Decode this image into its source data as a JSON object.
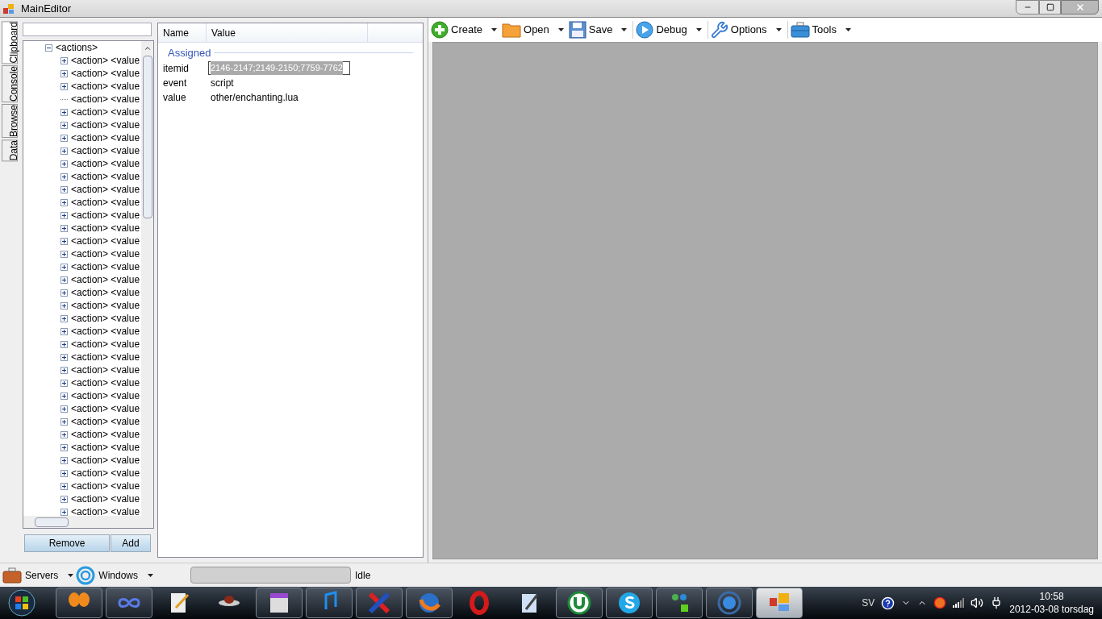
{
  "window": {
    "title": "MainEditor"
  },
  "side_tabs": [
    {
      "label": "Clipboard",
      "selected": true
    },
    {
      "label": "Console",
      "selected": false
    },
    {
      "label": "Browse",
      "selected": false
    },
    {
      "label": "Data",
      "selected": false
    }
  ],
  "tree": {
    "root": {
      "label": "<actions>",
      "expanded": true,
      "children": [
        {
          "label": "<action> <value",
          "expandable": true
        },
        {
          "label": "<action> <value",
          "expandable": true
        },
        {
          "label": "<action> <value",
          "expandable": true
        },
        {
          "label": "<action> <value",
          "expandable": false
        },
        {
          "label": "<action> <value",
          "expandable": true
        },
        {
          "label": "<action> <value",
          "expandable": true
        },
        {
          "label": "<action> <value",
          "expandable": true
        },
        {
          "label": "<action> <value",
          "expandable": true
        },
        {
          "label": "<action> <value",
          "expandable": true
        },
        {
          "label": "<action> <value",
          "expandable": true
        },
        {
          "label": "<action> <value",
          "expandable": true
        },
        {
          "label": "<action> <value",
          "expandable": true
        },
        {
          "label": "<action> <value",
          "expandable": true
        },
        {
          "label": "<action> <value",
          "expandable": true
        },
        {
          "label": "<action> <value",
          "expandable": true
        },
        {
          "label": "<action> <value",
          "expandable": true
        },
        {
          "label": "<action> <value",
          "expandable": true
        },
        {
          "label": "<action> <value",
          "expandable": true
        },
        {
          "label": "<action> <value",
          "expandable": true
        },
        {
          "label": "<action> <value",
          "expandable": true
        },
        {
          "label": "<action> <value",
          "expandable": true
        },
        {
          "label": "<action> <value",
          "expandable": true
        },
        {
          "label": "<action> <value",
          "expandable": true
        },
        {
          "label": "<action> <value",
          "expandable": true
        },
        {
          "label": "<action> <value",
          "expandable": true
        },
        {
          "label": "<action> <value",
          "expandable": true
        },
        {
          "label": "<action> <value",
          "expandable": true
        },
        {
          "label": "<action> <value",
          "expandable": true
        },
        {
          "label": "<action> <value",
          "expandable": true
        },
        {
          "label": "<action> <value",
          "expandable": true
        },
        {
          "label": "<action> <value",
          "expandable": true
        },
        {
          "label": "<action> <value",
          "expandable": true
        },
        {
          "label": "<action> <value",
          "expandable": true
        },
        {
          "label": "<action> <value",
          "expandable": true
        },
        {
          "label": "<action> <value",
          "expandable": true
        },
        {
          "label": "<action> <value",
          "expandable": true
        }
      ]
    }
  },
  "tree_buttons": [
    "Remove",
    "Add"
  ],
  "property_grid": {
    "columns": [
      "Name",
      "Value"
    ],
    "category": "Assigned",
    "rows": [
      {
        "name": "itemid",
        "value": "2146-2147;2149-2150;7759-7762",
        "editing": true
      },
      {
        "name": "event",
        "value": "script",
        "editing": false
      },
      {
        "name": "value",
        "value": "other/enchanting.lua",
        "editing": false
      }
    ]
  },
  "toolbar": [
    {
      "kind": "create",
      "label": "Create"
    },
    {
      "kind": "open",
      "label": "Open"
    },
    {
      "kind": "save",
      "label": "Save"
    },
    {
      "kind": "debug",
      "label": "Debug"
    },
    {
      "kind": "options",
      "label": "Options"
    },
    {
      "kind": "tools",
      "label": "Tools"
    }
  ],
  "status_bar": {
    "menus": [
      {
        "kind": "servers",
        "label": "Servers"
      },
      {
        "kind": "windows",
        "label": "Windows"
      }
    ],
    "progress": {
      "level": 0
    },
    "status": "Idle"
  },
  "taskbar": {
    "apps": [
      {
        "kind": "butterfly",
        "running": true,
        "selected": false
      },
      {
        "kind": "infinity",
        "running": true,
        "selected": false
      },
      {
        "kind": "notepad",
        "running": false,
        "selected": false
      },
      {
        "kind": "ufo",
        "running": false,
        "selected": false
      },
      {
        "kind": "store",
        "running": true,
        "selected": false
      },
      {
        "kind": "music",
        "running": true,
        "selected": false
      },
      {
        "kind": "cross",
        "running": true,
        "selected": false
      },
      {
        "kind": "firefox",
        "running": true,
        "selected": false
      },
      {
        "kind": "opera",
        "running": false,
        "selected": false
      },
      {
        "kind": "pen",
        "running": false,
        "selected": false
      },
      {
        "kind": "torrent",
        "running": true,
        "selected": false
      },
      {
        "kind": "skype",
        "running": true,
        "selected": false
      },
      {
        "kind": "messenger",
        "running": true,
        "selected": false
      },
      {
        "kind": "globe",
        "running": true,
        "selected": false
      },
      {
        "kind": "tiles",
        "running": true,
        "selected": true
      }
    ],
    "language": "SV",
    "time": "10:58",
    "date": "2012-03-08 torsdag"
  }
}
